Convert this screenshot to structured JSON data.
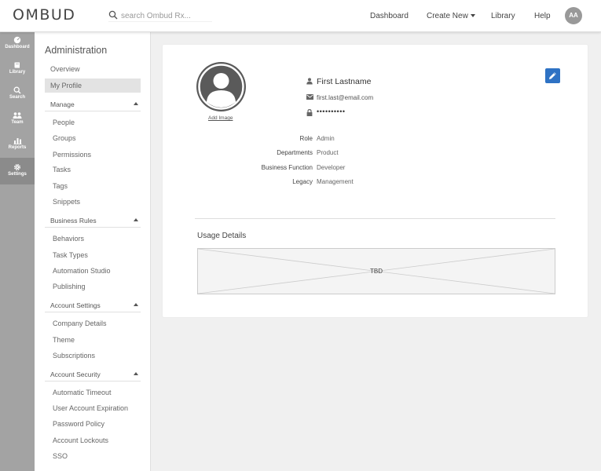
{
  "header": {
    "logo": "OMBUD",
    "search_placeholder": "search Ombud Rx...",
    "nav": {
      "dashboard": "Dashboard",
      "create_new": "Create New",
      "library": "Library",
      "help": "Help"
    },
    "avatar_initials": "AA"
  },
  "rail": {
    "items": [
      {
        "label": "Dashboard",
        "icon": "dashboard-icon"
      },
      {
        "label": "Library",
        "icon": "book-icon"
      },
      {
        "label": "Search",
        "icon": "search-icon"
      },
      {
        "label": "Team",
        "icon": "team-icon"
      },
      {
        "label": "Reports",
        "icon": "chart-icon"
      },
      {
        "label": "Settings",
        "icon": "gear-icon",
        "active": true
      }
    ]
  },
  "sidebar": {
    "title": "Administration",
    "overview": "Overview",
    "my_profile": "My Profile",
    "sections": [
      {
        "label": "Manage",
        "items": [
          "People",
          "Groups",
          "Permissions",
          "Tasks",
          "Tags",
          "Snippets"
        ]
      },
      {
        "label": "Business Rules",
        "items": [
          "Behaviors",
          "Task Types",
          "Automation Studio",
          "Publishing"
        ]
      },
      {
        "label": "Account Settings",
        "items": [
          "Company Details",
          "Theme",
          "Subscriptions"
        ]
      },
      {
        "label": "Account Security",
        "items": [
          "Automatic Timeout",
          "User Account Expiration",
          "Password Policy",
          "Account Lockouts",
          "SSO"
        ]
      }
    ]
  },
  "profile": {
    "add_image": "Add Image",
    "name": "First Lastname",
    "email": "first.last@email.com",
    "password": "••••••••••",
    "details": [
      {
        "label": "Role",
        "value": "Admin"
      },
      {
        "label": "Departments",
        "value": "Product"
      },
      {
        "label": "Business Function",
        "value": "Developer"
      },
      {
        "label": "Legacy",
        "value": "Management"
      }
    ],
    "edit_icon": "pencil-icon",
    "accent_color": "#2e72c4"
  },
  "usage": {
    "title": "Usage Details",
    "placeholder": "TBD"
  }
}
